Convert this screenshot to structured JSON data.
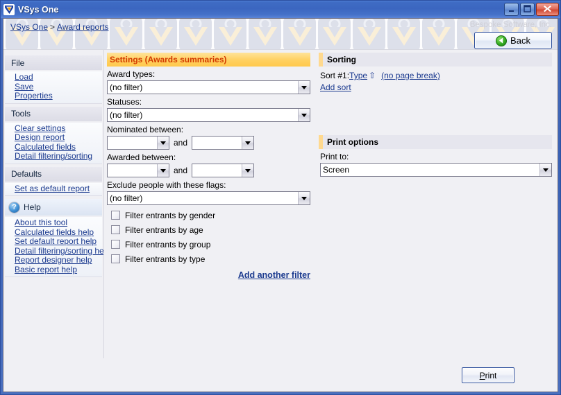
{
  "window": {
    "title": "VSys One",
    "icon": "app-checkmark-icon",
    "minimize_label": "Minimize",
    "maximize_label": "Maximize",
    "close_label": "Close"
  },
  "banner": {
    "breadcrumb": {
      "root": "VSys One",
      "separator": ">",
      "current": "Award reports"
    },
    "brand": "Bespoke Software, Inc.",
    "back_label": "Back",
    "tile_count": 16
  },
  "sidebar": {
    "groups": [
      {
        "title": "File",
        "items": [
          "Load",
          "Save",
          "Properties"
        ]
      },
      {
        "title": "Tools",
        "items": [
          "Clear settings",
          "Design report",
          "Calculated fields",
          "Detail filtering/sorting"
        ]
      },
      {
        "title": "Defaults",
        "items": [
          "Set as default report"
        ]
      },
      {
        "title": "Help",
        "icon": "question-mark-icon",
        "items": [
          "About this tool",
          "Calculated fields help",
          "Set default report help",
          "Detail filtering/sorting help",
          "Report designer help",
          "Basic report help"
        ]
      }
    ]
  },
  "settings": {
    "header": "Settings (Awards summaries)",
    "award_types": {
      "label": "Award types:",
      "value": "(no filter)"
    },
    "statuses": {
      "label": "Statuses:",
      "value": "(no filter)"
    },
    "nominated_between": {
      "label": "Nominated between:",
      "from": "",
      "and": "and",
      "to": ""
    },
    "awarded_between": {
      "label": "Awarded between:",
      "from": "",
      "and": "and",
      "to": ""
    },
    "exclude_flags": {
      "label": "Exclude people with these flags:",
      "value": "(no filter)"
    },
    "checkboxes": [
      {
        "label": "Filter entrants by gender",
        "checked": false
      },
      {
        "label": "Filter entrants by age",
        "checked": false
      },
      {
        "label": "Filter entrants by group",
        "checked": false
      },
      {
        "label": "Filter entrants by type",
        "checked": false
      }
    ],
    "add_another_filter": "Add another filter"
  },
  "sorting": {
    "header": "Sorting",
    "sort_prefix": "Sort #1:",
    "sort_field": "Type",
    "sort_direction_icon": "arrow-up-icon",
    "page_break": "(no page break)",
    "add_sort": "Add sort"
  },
  "print_options": {
    "header": "Print options",
    "print_to_label": "Print to:",
    "print_to_value": "Screen"
  },
  "footer": {
    "print_label": "Print",
    "print_accel": "P"
  },
  "colors": {
    "title_bar": "#3f6cc4",
    "settings_header": "#ffd060",
    "settings_header_text": "#d33a00",
    "link": "#1b3a8f",
    "accent_amber": "#ffd98f",
    "client_bg": "#f0f0f4"
  }
}
